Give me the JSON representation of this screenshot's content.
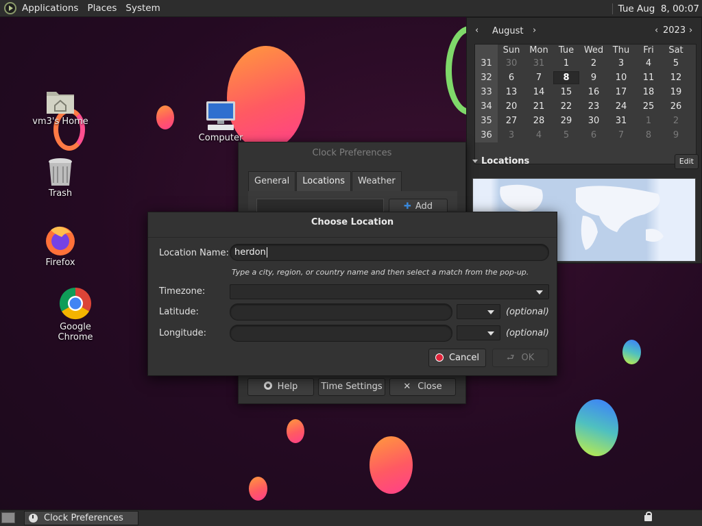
{
  "top_panel": {
    "menus": [
      "Applications",
      "Places",
      "System"
    ],
    "clock": "Tue Aug  8, 00:07"
  },
  "desktop": {
    "icons": [
      {
        "label": "vm3's Home",
        "icon": "home-folder-icon"
      },
      {
        "label": "Computer",
        "icon": "computer-icon"
      },
      {
        "label": "Trash",
        "icon": "trash-icon"
      },
      {
        "label": "Firefox",
        "icon": "firefox-icon"
      },
      {
        "label": "Google Chrome",
        "icon": "chrome-icon"
      }
    ]
  },
  "calendar": {
    "month": "August",
    "year": "2023",
    "prev_arrow": "‹",
    "next_arrow": "›",
    "day_names": [
      "Sun",
      "Mon",
      "Tue",
      "Wed",
      "Thu",
      "Fri",
      "Sat"
    ],
    "weeks": [
      {
        "num": "31",
        "days": [
          "30",
          "31",
          "1",
          "2",
          "3",
          "4",
          "5"
        ]
      },
      {
        "num": "32",
        "days": [
          "6",
          "7",
          "8",
          "9",
          "10",
          "11",
          "12"
        ]
      },
      {
        "num": "33",
        "days": [
          "13",
          "14",
          "15",
          "16",
          "17",
          "18",
          "19"
        ]
      },
      {
        "num": "34",
        "days": [
          "20",
          "21",
          "22",
          "23",
          "24",
          "25",
          "26"
        ]
      },
      {
        "num": "35",
        "days": [
          "27",
          "28",
          "29",
          "30",
          "31",
          "1",
          "2"
        ]
      },
      {
        "num": "36",
        "days": [
          "3",
          "4",
          "5",
          "6",
          "7",
          "8",
          "9"
        ]
      }
    ],
    "today": "8",
    "locations_title": "Locations",
    "edit_label": "Edit"
  },
  "clock_preferences": {
    "title": "Clock Preferences",
    "tabs": [
      "General",
      "Locations",
      "Weather"
    ],
    "active_tab": "Locations",
    "add_label": "Add",
    "buttons": {
      "help": "Help",
      "time_settings": "Time Settings",
      "close": "Close"
    }
  },
  "choose_location": {
    "title": "Choose Location",
    "location_name_label": "Location Name:",
    "location_name_value": "herdon",
    "hint": "Type a city, region, or country name and then select a match from the pop-up.",
    "timezone_label": "Timezone:",
    "latitude_label": "Latitude:",
    "longitude_label": "Longitude:",
    "optional": "(optional)",
    "cancel_label": "Cancel",
    "ok_label": "OK"
  },
  "bottom_panel": {
    "task_label": "Clock Preferences"
  },
  "colors": {
    "bubble_warm": "#ff5a62",
    "bubble_cool": "#4fc0c0",
    "cancel_icon": "#e0243a",
    "add_icon": "#3d8fe6"
  }
}
